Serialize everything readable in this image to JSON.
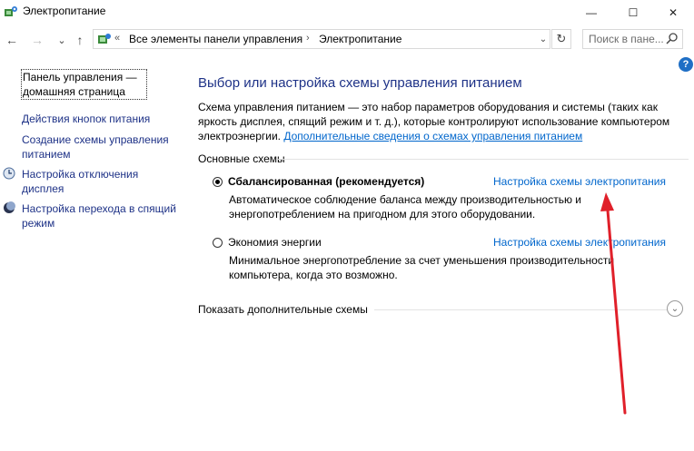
{
  "window": {
    "title": "Электропитание",
    "minimize_glyph": "—",
    "maximize_glyph": "☐",
    "close_glyph": "✕"
  },
  "nav": {
    "back_glyph": "←",
    "forward_glyph": "→",
    "recent_glyph": "⌄",
    "up_glyph": "↑",
    "breadcrumb_overflow": "«",
    "breadcrumb": [
      "Все элементы панели управления",
      "Электропитание"
    ],
    "breadcrumb_sep": "›",
    "dropdown_glyph": "⌄",
    "refresh_glyph": "↻",
    "search_placeholder": "Поиск в пане..."
  },
  "help": {
    "label": "?"
  },
  "sidebar": {
    "home_link": "Панель управления — домашняя страница",
    "items": [
      {
        "label": "Действия кнопок питания",
        "icon": "none"
      },
      {
        "label": "Создание схемы управления питанием",
        "icon": "none"
      },
      {
        "label": "Настройка отключения дисплея",
        "icon": "display-clock-icon"
      },
      {
        "label": "Настройка перехода в спящий режим",
        "icon": "moon-icon"
      }
    ]
  },
  "main": {
    "heading": "Выбор или настройка схемы управления питанием",
    "description": "Схема управления питанием — это набор параметров оборудования и системы (таких как яркость дисплея, спящий режим и т. д.), которые контролируют использование компьютером электроэнергии.",
    "more_info_link": "Дополнительные сведения о схемах управления питанием",
    "section_label": "Основные схемы",
    "plans": [
      {
        "name": "Сбалансированная (рекомендуется)",
        "selected": true,
        "settings_link": "Настройка схемы электропитания",
        "description": "Автоматическое соблюдение баланса между производительностью и энергопотреблением на пригодном для этого оборудовании."
      },
      {
        "name": "Экономия энергии",
        "selected": false,
        "settings_link": "Настройка схемы электропитания",
        "description": "Минимальное энергопотребление за счет уменьшения производительности компьютера, когда это возможно."
      }
    ],
    "show_more_label": "Показать дополнительные схемы",
    "expand_glyph": "⌄"
  },
  "colors": {
    "heading": "#1e3287",
    "link": "#0066cc",
    "annotation_arrow": "#e0202a"
  }
}
